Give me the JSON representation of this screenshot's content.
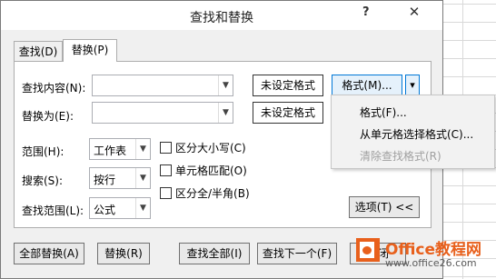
{
  "dialog": {
    "title": "查找和替换",
    "help": "?",
    "close": "✕"
  },
  "tabs": [
    {
      "label": "查找(D)"
    },
    {
      "label": "替换(P)"
    }
  ],
  "find": {
    "label": "查找内容(N):",
    "value": "",
    "format_status": "未设定格式"
  },
  "replace": {
    "label": "替换为(E):",
    "value": "",
    "format_status": "未设定格式"
  },
  "format_button": {
    "label": "格式(M)...",
    "arrow": "▾"
  },
  "format_menu": {
    "items": [
      {
        "label": "格式(F)...",
        "enabled": true
      },
      {
        "label": "从单元格选择格式(C)...",
        "enabled": true
      },
      {
        "label": "清除查找格式(R)",
        "enabled": false
      }
    ]
  },
  "options": {
    "scope": {
      "label": "范围(H):",
      "value": "工作表"
    },
    "search": {
      "label": "搜索(S):",
      "value": "按行"
    },
    "lookin": {
      "label": "查找范围(L):",
      "value": "公式"
    },
    "match_case": {
      "label": "区分大小写(C)",
      "checked": false
    },
    "match_cell": {
      "label": "单元格匹配(O)",
      "checked": false
    },
    "match_byte": {
      "label": "区分全/半角(B)",
      "checked": false
    },
    "options_button": "选项(T) <<"
  },
  "buttons": {
    "replace_all": "全部替换(A)",
    "replace": "替换(R)",
    "find_all": "查找全部(I)",
    "find_next": "查找下一个(F)",
    "close": "关闭"
  },
  "watermark": {
    "name": "Office教程网",
    "url": "www.office26.com"
  },
  "colors": {
    "accent": "#0078d7",
    "brand": "#e8601c",
    "disabled": "#a0a0a0"
  }
}
